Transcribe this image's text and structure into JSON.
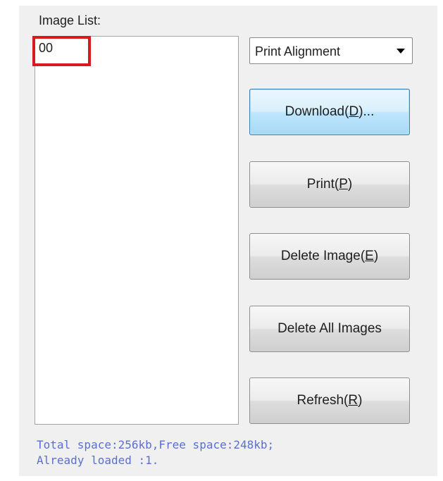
{
  "image_list": {
    "label": "Image List:",
    "items": [
      "00"
    ]
  },
  "dropdown": {
    "selected": "Print Alignment"
  },
  "buttons": {
    "download": {
      "text": "Download(",
      "mnemonic": "D",
      "suffix": ")..."
    },
    "print": {
      "text": "Print(",
      "mnemonic": "P",
      "suffix": ")"
    },
    "delete_image": {
      "text": "Delete Image(",
      "mnemonic": "E",
      "suffix": ")"
    },
    "delete_all": {
      "text": "Delete All Images"
    },
    "refresh": {
      "text": "Refresh(",
      "mnemonic": "R",
      "suffix": ")"
    }
  },
  "status": {
    "line1": "Total space:256kb,Free space:248kb;",
    "line2": "Already loaded :1."
  },
  "colors": {
    "highlight": "#d71920",
    "status_text": "#5a6fd0",
    "focus_border": "#3c7fb1"
  }
}
